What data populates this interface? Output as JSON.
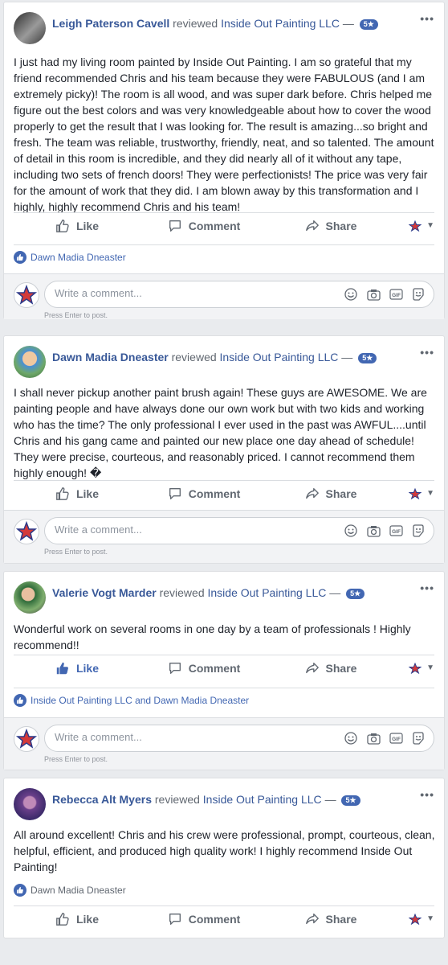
{
  "common": {
    "reviewed": "reviewed",
    "dash": "—",
    "more": "•••",
    "like": "Like",
    "comment": "Comment",
    "share": "Share",
    "placeholder": "Write a comment...",
    "hint": "Press Enter to post.",
    "gif": "GIF",
    "accent": "#4267b2"
  },
  "reviews": [
    {
      "author": "Leigh Paterson Cavell",
      "page": "Inside Out Painting LLC",
      "rating": "5★",
      "text": "I just had my living room painted by Inside Out Painting. I am so grateful that my friend recommended Chris and his team because they were FABULOUS (and I am extremely picky)! The room is all wood, and was super dark before. Chris helped me figure out the best colors and was very knowledgeable about how to cover the wood properly to get the result that I was looking for. The result is amazing...so bright and fresh. The team was reliable, trustworthy, friendly, neat, and so talented. The amount of detail in this room is incredible, and they did nearly all of it without any tape, including two sets of french doors! They were perfectionists! The price was very fair for the amount of work that they did. I am blown away by this transformation and I highly, highly recommend Chris and his team!",
      "reactors": "Dawn Madia Dneaster"
    },
    {
      "author": "Dawn Madia Dneaster",
      "page": "Inside Out Painting LLC",
      "rating": "5★",
      "text": "I shall never pickup another paint brush again! These guys are AWESOME. We are painting people and have always done our own work but with two kids and working who has the time? The only professional I ever used in the past was AWFUL....until Chris and his gang came and painted our new place one day ahead of schedule! They were precise, courteous, and reasonably priced. I cannot recommend them highly enough! �"
    },
    {
      "author": "Valerie Vogt Marder",
      "page": "Inside Out Painting LLC",
      "rating": "5★",
      "text": "Wonderful work on several rooms in one day by a team of professionals ! Highly recommend!!",
      "reactors": "Inside Out Painting LLC and Dawn Madia Dneaster"
    },
    {
      "author": "Rebecca Alt Myers",
      "page": "Inside Out Painting LLC",
      "rating": "5★",
      "text": "All around excellent! Chris and his crew were professional, prompt, courteous, clean, helpful, efficient, and produced high quality work! I highly recommend Inside Out Painting!",
      "reactors": "Dawn Madia Dneaster"
    }
  ]
}
